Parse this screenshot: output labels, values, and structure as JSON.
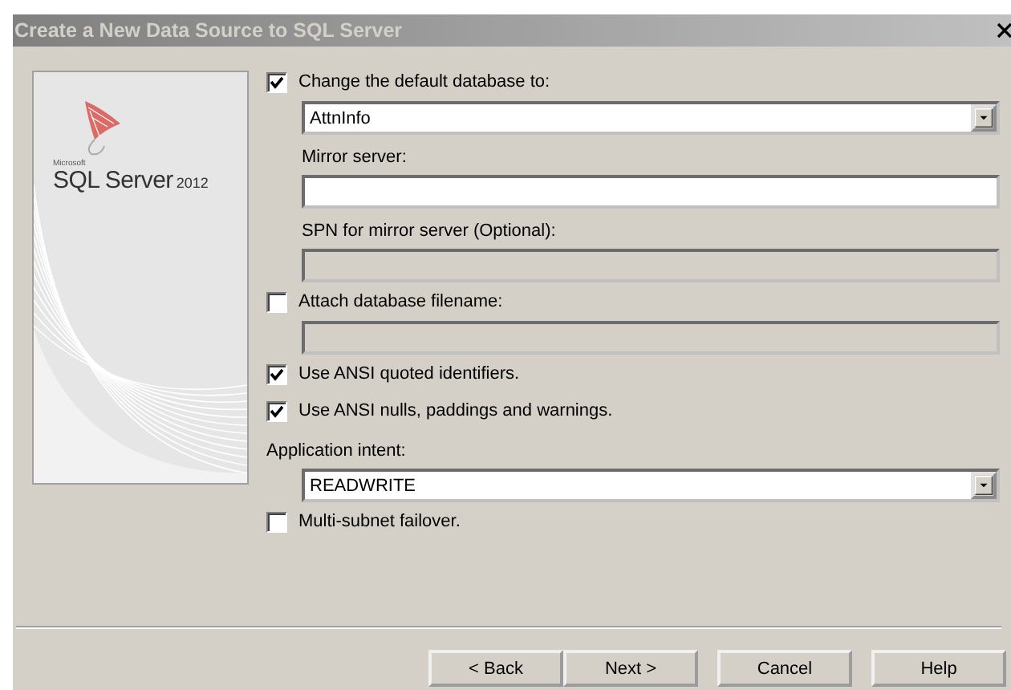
{
  "window": {
    "title": "Create a New Data Source to SQL Server"
  },
  "logo": {
    "maker": "Microsoft",
    "product": "SQL Server",
    "version": "2012"
  },
  "options": [
    {
      "kind": "checkbox",
      "label": "Change the default database to:",
      "checked": true
    },
    {
      "kind": "combo",
      "value": "AttnInfo",
      "indented": true
    },
    {
      "kind": "label",
      "label": "Mirror server:"
    },
    {
      "kind": "field",
      "disabled": false,
      "indented": true
    },
    {
      "kind": "label",
      "label": "SPN for mirror server (Optional):"
    },
    {
      "kind": "field",
      "disabled": true,
      "indented": true
    },
    {
      "kind": "checkbox",
      "label": "Attach database filename:",
      "checked": false
    },
    {
      "kind": "field",
      "disabled": true,
      "indented": true
    },
    {
      "kind": "checkbox",
      "label": "Use ANSI quoted identifiers.",
      "checked": true
    },
    {
      "kind": "checkbox",
      "label": "Use ANSI nulls, paddings and warnings.",
      "checked": true
    },
    {
      "kind": "heading",
      "label": "Application intent:"
    },
    {
      "kind": "combo",
      "value": "READWRITE",
      "indented": true
    },
    {
      "kind": "checkbox",
      "label": "Multi-subnet failover.",
      "checked": false
    }
  ],
  "buttons": [
    {
      "label": "< Back"
    },
    {
      "label": "Next >"
    },
    {
      "label": "Cancel"
    },
    {
      "label": "Help"
    }
  ]
}
